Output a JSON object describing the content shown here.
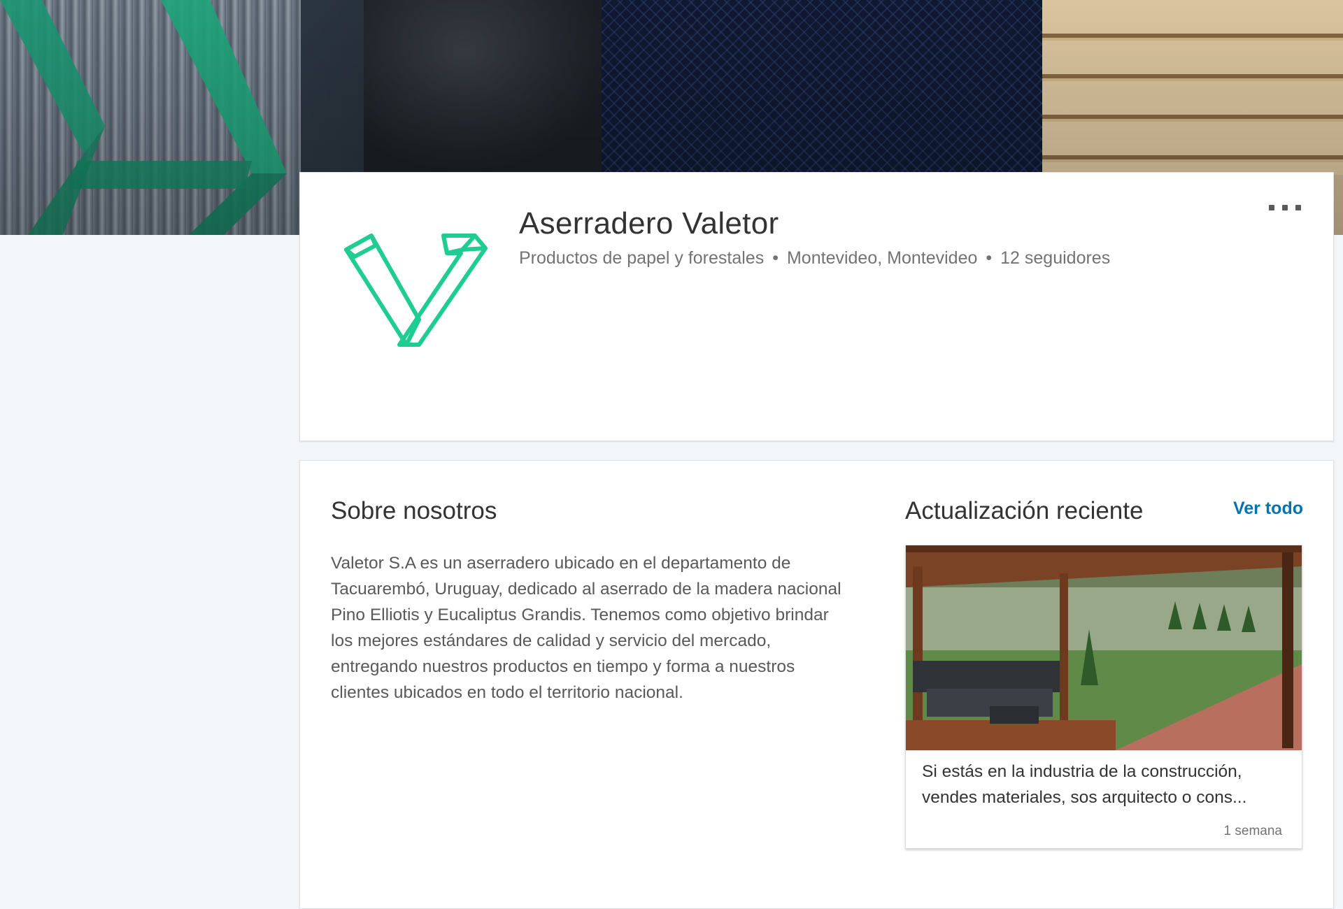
{
  "company": {
    "name": "Aserradero Valetor",
    "industry": "Productos de papel y forestales",
    "location": "Montevideo, Montevideo",
    "followers": "12 seguidores",
    "separator": "•",
    "logo_icon": "valetor-v-logo",
    "brand_color": "#1fcc91"
  },
  "about": {
    "title": "Sobre nosotros",
    "description": "Valetor S.A es un aserradero ubicado en el departamento de Tacuarembó, Uruguay, dedicado al aserrado de la madera nacional Pino Elliotis y Eucaliptus Grandis. Tenemos como objetivo brindar los mejores estándares de calidad y servicio del mercado, entregando nuestros productos en tiempo y forma a nuestros clientes ubicados en todo el territorio nacional."
  },
  "updates": {
    "title": "Actualización reciente",
    "see_all": "Ver todo",
    "link_color": "#0073b1",
    "latest": {
      "text": "Si estás en la industria de la construcción, vendes materiales, sos arquitecto o cons...",
      "time": "1 semana",
      "image_icon": "wooden-deck-photo"
    }
  },
  "menu": {
    "icon": "more-options-icon"
  }
}
